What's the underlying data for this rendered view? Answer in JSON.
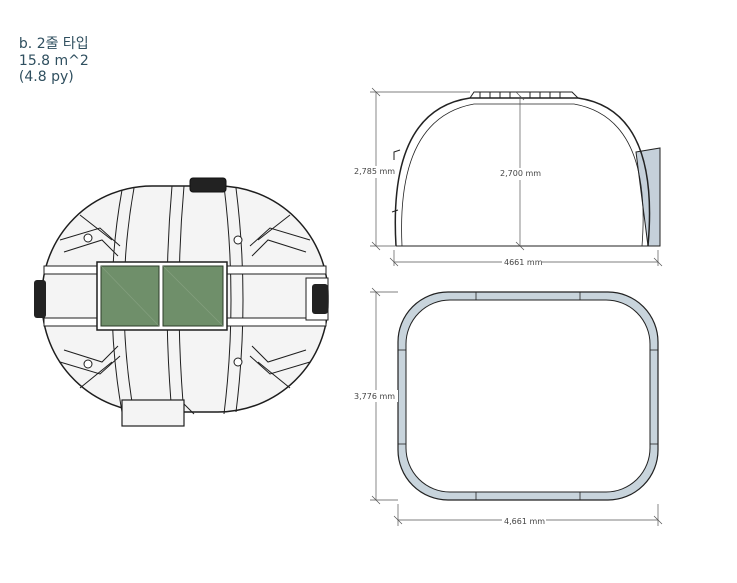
{
  "caption": {
    "label": "b. 2줄 타입",
    "area": "15.8 m^2",
    "pyeong": "(4.8 py)"
  },
  "side_view": {
    "height_outer": "2,785 mm",
    "height_inner": "2,700 mm",
    "width": "4661 mm"
  },
  "plan_view": {
    "depth": "3,776 mm",
    "width": "4,661 mm"
  },
  "colors": {
    "caption_text": "#2f4f5f",
    "dome_fill": "#f4f4f4",
    "dome_rib": "#ffffff",
    "window_green": "#6f8f6a",
    "outline": "#222222",
    "plan_ring": "#c8d4dc",
    "canopy": "#c5d0da"
  }
}
